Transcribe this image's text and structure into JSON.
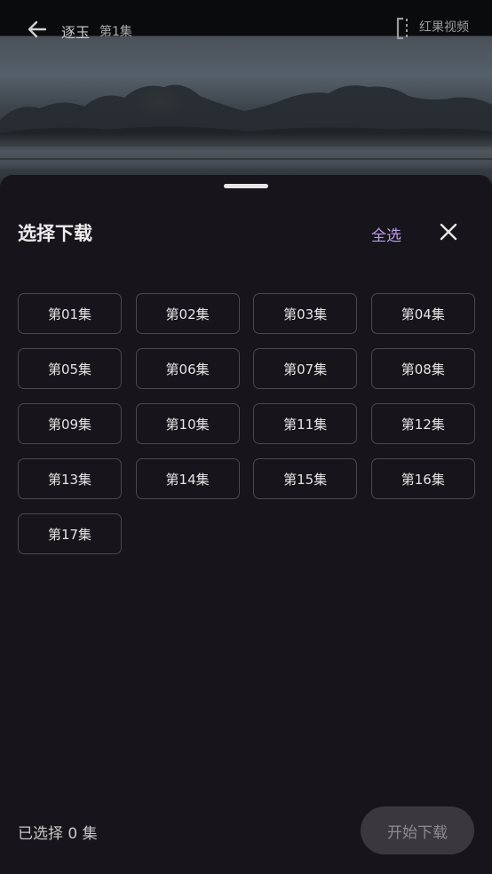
{
  "header": {
    "title": "逐玉",
    "episode": "第1集",
    "watermark": "红果视频"
  },
  "sheet": {
    "title": "选择下载",
    "select_all": "全选",
    "episodes": [
      "第01集",
      "第02集",
      "第03集",
      "第04集",
      "第05集",
      "第06集",
      "第07集",
      "第08集",
      "第09集",
      "第10集",
      "第11集",
      "第12集",
      "第13集",
      "第14集",
      "第15集",
      "第16集",
      "第17集"
    ],
    "selected_text": "已选择 0 集",
    "start_download": "开始下载"
  },
  "colors": {
    "sheet_background": "#17141b",
    "accent": "#b99de8",
    "button_border": "#4a4750",
    "disabled_button": "#3a383e"
  },
  "icons": {
    "back": "arrow-left-icon",
    "cast": "cast-icon",
    "close": "close-icon"
  }
}
